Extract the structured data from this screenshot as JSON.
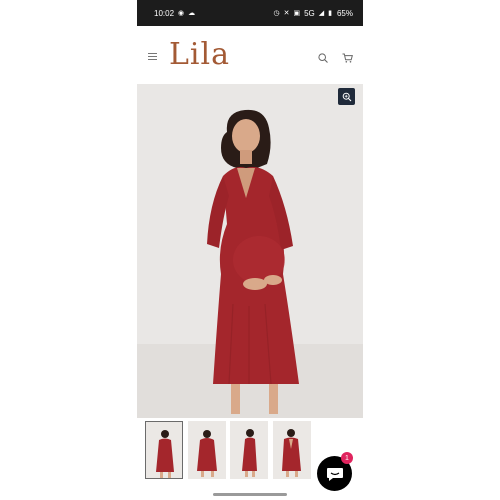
{
  "status_bar": {
    "time": "10:02",
    "network": "5G",
    "battery": "65%",
    "icons": [
      "whatsapp-icon",
      "cloud-icon",
      "alarm-icon",
      "mute-icon",
      "nfc-icon",
      "signal-icon",
      "battery-icon"
    ]
  },
  "header": {
    "logo": "Lila",
    "icons": [
      "menu-icon",
      "search-icon",
      "cart-icon"
    ]
  },
  "product": {
    "hero_icons": [
      "zoom-in-icon"
    ],
    "thumbnails_count": 4,
    "active_thumbnail": 0
  },
  "chat": {
    "badge_count": "1",
    "icon": "chat-bubble-icon"
  },
  "colors": {
    "brand": "#a35a35",
    "dress": "#a4262c",
    "zoom_button": "#1f2a3a",
    "chat_badge": "#e0245e"
  }
}
